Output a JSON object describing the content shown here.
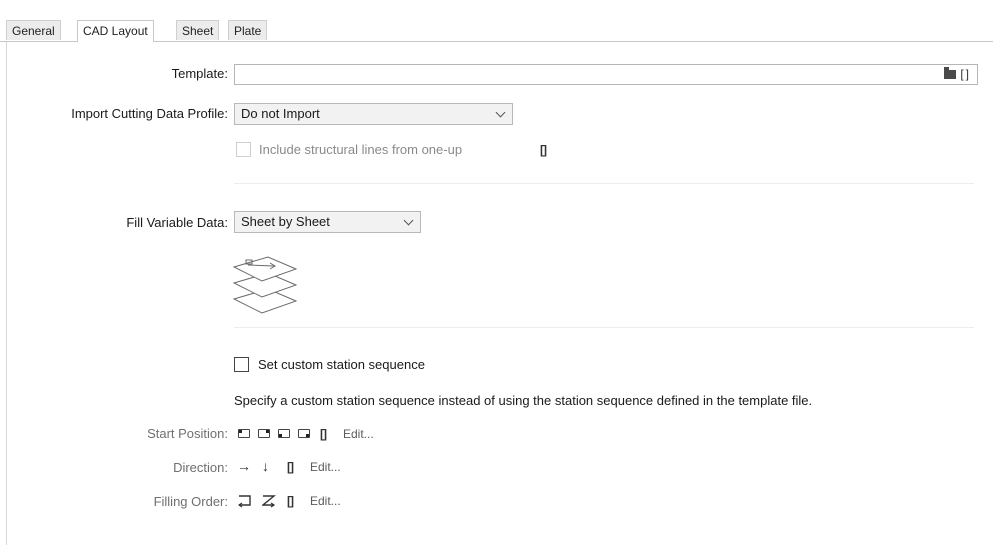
{
  "tabs": [
    {
      "label": "General"
    },
    {
      "label": "CAD Layout"
    },
    {
      "label": "Sheet"
    },
    {
      "label": "Plate"
    }
  ],
  "active_tab": "CAD Layout",
  "template": {
    "label": "Template:",
    "value": "",
    "icons": [
      "folder-icon",
      "bracket-icon"
    ]
  },
  "import_cutting": {
    "label": "Import Cutting Data Profile:",
    "selected": "Do not Import"
  },
  "include_structural": {
    "label": "Include structural lines from one-up",
    "checked": false,
    "enabled": false
  },
  "fill_variable": {
    "label": "Fill Variable Data:",
    "selected": "Sheet by Sheet",
    "illustration": "stacked-sheets-icon"
  },
  "custom_sequence": {
    "checkbox_label": "Set custom station sequence",
    "checked": false,
    "description": "Specify a custom station sequence instead of using the station sequence defined in the template file."
  },
  "start_position": {
    "label": "Start Position:",
    "options": [
      "top-left",
      "top-right",
      "bottom-left",
      "bottom-right"
    ],
    "edit": "Edit..."
  },
  "direction": {
    "label": "Direction:",
    "glyphs": [
      "→",
      "↓"
    ],
    "edit": "Edit..."
  },
  "filling_order": {
    "label": "Filling Order:",
    "edit": "Edit..."
  },
  "bracket_glyph": "[]"
}
